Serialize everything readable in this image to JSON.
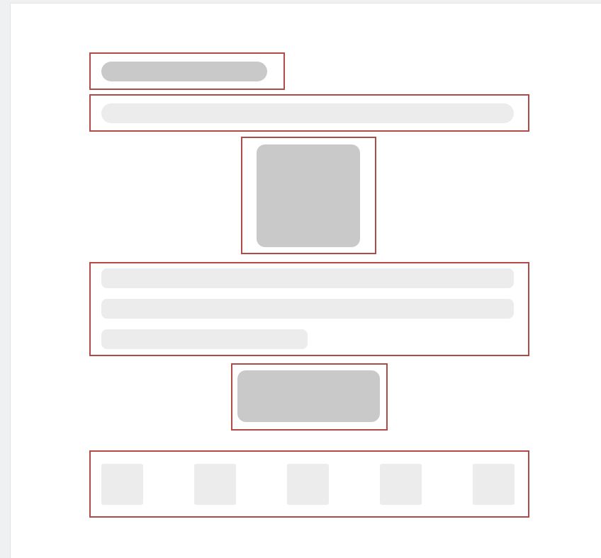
{
  "layout_wireframe": {
    "colors": {
      "outline": "#b34a4a",
      "placeholder_dark": "#c9c9c9",
      "placeholder_light": "#ececec",
      "background": "#ffffff",
      "backdrop": "#eef0f2"
    },
    "regions": [
      {
        "role": "title-placeholder"
      },
      {
        "role": "subtitle-placeholder"
      },
      {
        "role": "image-placeholder"
      },
      {
        "role": "paragraph-placeholder",
        "lines": 3
      },
      {
        "role": "button-placeholder"
      },
      {
        "role": "tile-row-placeholder",
        "tiles": 5
      }
    ]
  }
}
